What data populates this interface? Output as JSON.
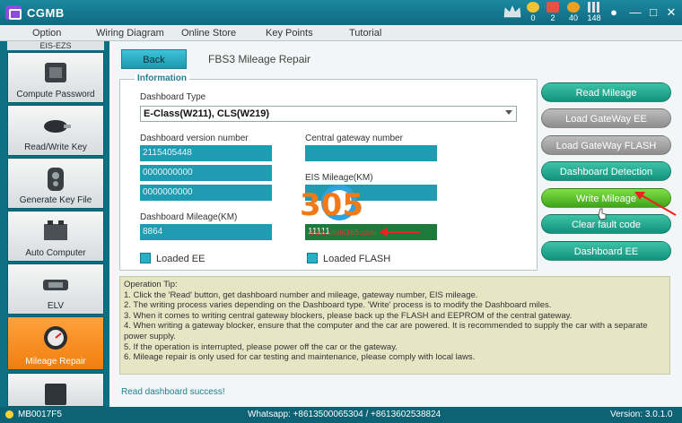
{
  "app": {
    "title": "CGMB",
    "stats": [
      {
        "icon": "coin-icon",
        "value": "0",
        "color": "#f2c230"
      },
      {
        "icon": "gift-icon",
        "value": "2",
        "color": "#e85040"
      },
      {
        "icon": "medal-icon",
        "value": "40",
        "color": "#f0a020"
      },
      {
        "icon": "grid-icon",
        "value": "148",
        "color": "#e0e0e0"
      }
    ]
  },
  "menu": [
    "Option",
    "Wiring Diagram",
    "Online Store",
    "Key Points",
    "Tutorial"
  ],
  "sidebar": {
    "top_label": "EIS-EZS",
    "items": [
      {
        "label": "Compute Password",
        "icon": "chip-icon"
      },
      {
        "label": "Read/Write Key",
        "icon": "car-key-icon"
      },
      {
        "label": "Generate Key File",
        "icon": "key-fob-icon"
      },
      {
        "label": "Auto Computer",
        "icon": "ecu-icon"
      },
      {
        "label": "ELV",
        "icon": "steering-lock-icon"
      },
      {
        "label": "Mileage Repair",
        "icon": "odometer-icon",
        "active": true
      }
    ]
  },
  "main": {
    "back_label": "Back",
    "title": "FBS3 Mileage Repair",
    "info": {
      "legend": "Information",
      "dashboard_type_label": "Dashboard Type",
      "dashboard_type_value": "E-Class(W211),  CLS(W219)",
      "dashboard_version_label": "Dashboard version number",
      "dashboard_version_values": [
        "2115405448",
        "0000000000",
        "0000000000"
      ],
      "central_gateway_label": "Central gateway number",
      "central_gateway_value": "",
      "eis_mileage_label": "EIS Mileage(KM)",
      "eis_mileage_value": "",
      "dashboard_mileage_label": "Dashboard Mileage(KM)",
      "dashboard_mileage_value": "8864",
      "new_mileage_value": "11111",
      "loaded_ee_label": "Loaded EE",
      "loaded_flash_label": "Loaded FLASH"
    },
    "actions": [
      {
        "label": "Read Mileage",
        "style": "teal"
      },
      {
        "label": "Load GateWay EE",
        "style": "gray"
      },
      {
        "label": "Load GateWay FLASH",
        "style": "gray"
      },
      {
        "label": "Dashboard Detection",
        "style": "teal"
      },
      {
        "label": "Write Mileage",
        "style": "green"
      },
      {
        "label": "Clear fault code",
        "style": "teal"
      },
      {
        "label": "Dashboard EE",
        "style": "teal"
      }
    ],
    "tips": {
      "title": "Operation Tip:",
      "lines": [
        "1.  Click  the  'Read'  button,  get  dashboard  number  and  mileage,  gateway  number,  EIS  mileage.",
        "2.  The  writing  process  varies  depending  on  the  Dashboard  type.  'Write'  process  is  to  modify  the  Dashboard  miles.",
        "3.  When  it  comes  to  writing  central  gateway  blockers,  please  back  up  the  FLASH  and  EEPROM  of  the  central  gateway.",
        "4.  When  writing  a  gateway  blocker,  ensure  that  the  computer  and  the  car  are  powered.  It  is  recommended  to  supply  the  car  with  a  separate  power  supply.",
        "5.  If  the  operation  is  interrupted,  please  power  off  the  car  or  the  gateway.",
        "6.  Mileage  repair  is  only  used  for  car  testing  and  maintenance,  please  comply  with  local  laws."
      ]
    },
    "status": "Read  dashboard  success!"
  },
  "footer": {
    "device": "MB0017F5",
    "contact": "Whatsapp: +8613500065304 / +8613602538824",
    "version": "Version: 3.0.1.0"
  },
  "watermark": {
    "logo_text": "305",
    "url_text": "www.obdii365.com"
  },
  "colors": {
    "accent_teal": "#1f9bb2",
    "active_orange": "#f07e10",
    "write_green": "#3ea319"
  }
}
